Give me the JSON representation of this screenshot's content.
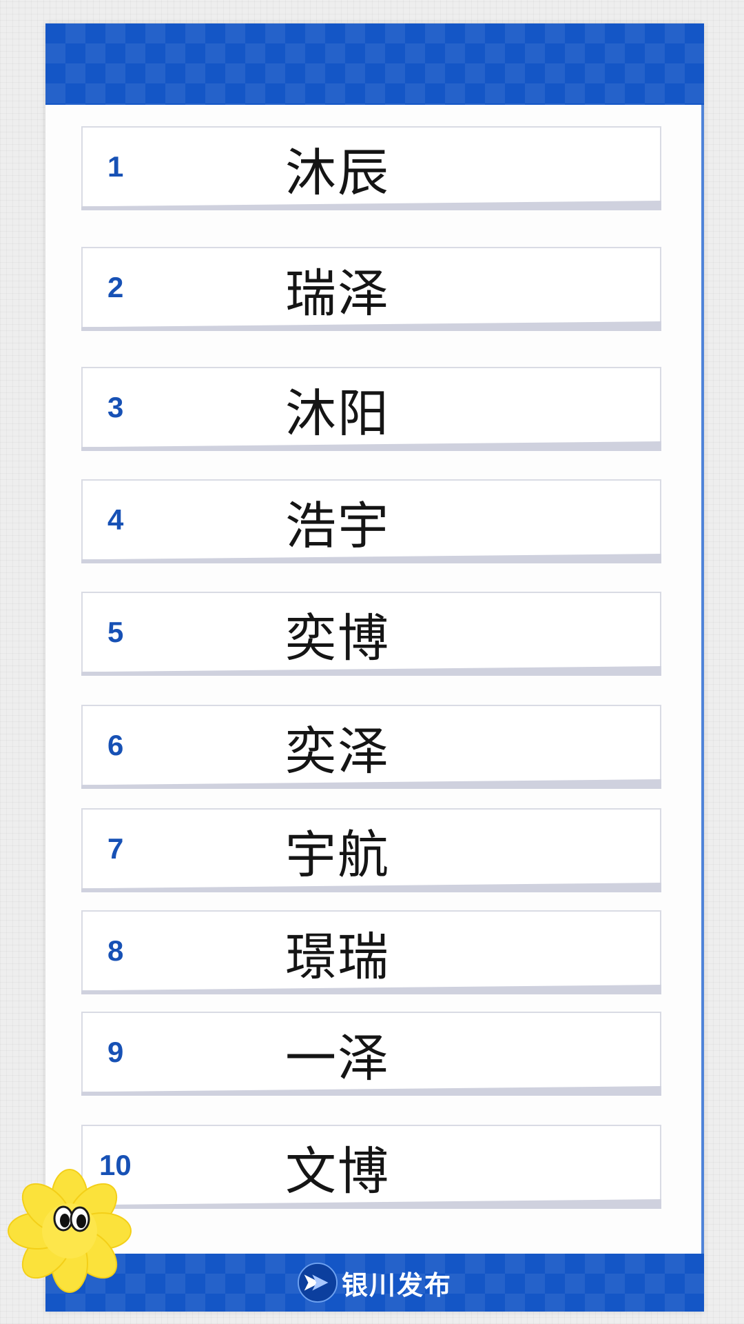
{
  "ranking": [
    {
      "rank": "1",
      "name": "沐辰"
    },
    {
      "rank": "2",
      "name": "瑞泽"
    },
    {
      "rank": "3",
      "name": "沐阳"
    },
    {
      "rank": "4",
      "name": "浩宇"
    },
    {
      "rank": "5",
      "name": "奕博"
    },
    {
      "rank": "6",
      "name": "奕泽"
    },
    {
      "rank": "7",
      "name": "宇航"
    },
    {
      "rank": "8",
      "name": "璟瑞"
    },
    {
      "rank": "9",
      "name": "一泽"
    },
    {
      "rank": "10",
      "name": "文博"
    }
  ],
  "footer": {
    "brand_name": "银川发布",
    "logo_icon": "chevron-arrow-logo-icon"
  },
  "decoration": {
    "mascot_icon": "yellow-flower-mascot-icon"
  },
  "colors": {
    "brand_blue": "#1456c6",
    "rank_blue": "#1751b5",
    "flower_yellow": "#fbe23b"
  }
}
